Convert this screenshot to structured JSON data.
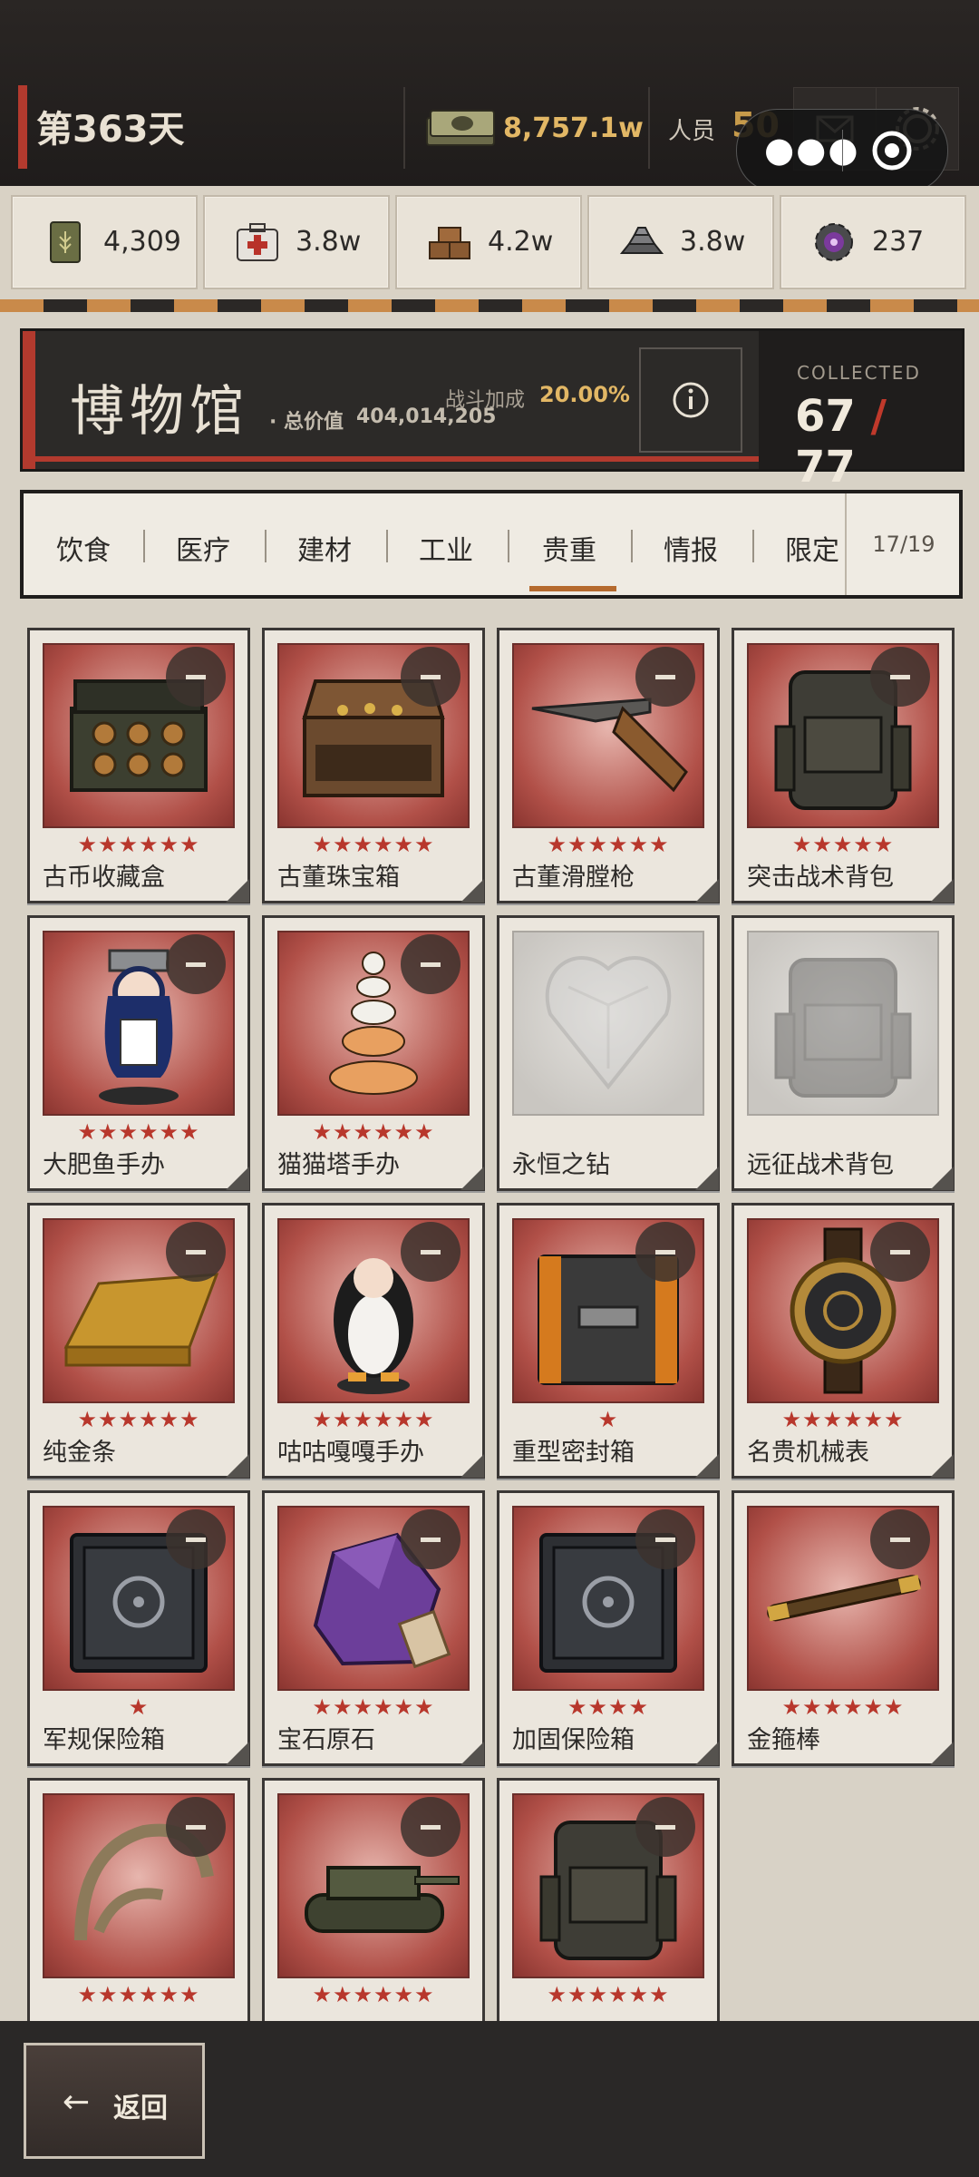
{
  "topbar": {
    "day": "第363天",
    "money": "8,757.1w",
    "people_label": "人员",
    "people_value": "50"
  },
  "resources": [
    {
      "icon": "food-can-icon",
      "value": "4,309"
    },
    {
      "icon": "medkit-icon",
      "value": "3.8w"
    },
    {
      "icon": "wood-blocks-icon",
      "value": "4.2w"
    },
    {
      "icon": "metal-ingots-icon",
      "value": "3.8w"
    },
    {
      "icon": "gear-chip-icon",
      "value": "237"
    }
  ],
  "museum": {
    "title": "博物馆",
    "total_label": "· 总价值",
    "total_value": "404,014,205",
    "bonus_label": "战斗加成",
    "bonus_value": "20.00%",
    "collected_label": "COLLECTED",
    "collected_count": "67",
    "collected_total": "77"
  },
  "tabs": {
    "items": [
      "饮食",
      "医疗",
      "建材",
      "工业",
      "贵重",
      "情报",
      "限定"
    ],
    "active": "贵重",
    "count": "17/19"
  },
  "items": [
    {
      "name": "古币收藏盒",
      "stars": "★★★★★★",
      "locked": false,
      "art": "coin-box"
    },
    {
      "name": "古董珠宝箱",
      "stars": "★★★★★★",
      "locked": false,
      "art": "jewel-chest"
    },
    {
      "name": "古董滑膛枪",
      "stars": "★★★★★★",
      "locked": false,
      "art": "musket"
    },
    {
      "name": "突击战术背包",
      "stars": "★★★★★",
      "locked": false,
      "art": "backpack"
    },
    {
      "name": "大肥鱼手办",
      "stars": "★★★★★★",
      "locked": false,
      "art": "figure-girl"
    },
    {
      "name": "猫猫塔手办",
      "stars": "★★★★★★",
      "locked": false,
      "art": "cat-tower"
    },
    {
      "name": "永恒之钻",
      "stars": "",
      "locked": true,
      "art": "diamond"
    },
    {
      "name": "远征战术背包",
      "stars": "",
      "locked": true,
      "art": "backpack"
    },
    {
      "name": "纯金条",
      "stars": "★★★★★★",
      "locked": false,
      "art": "gold-bar"
    },
    {
      "name": "咕咕嘎嘎手办",
      "stars": "★★★★★★",
      "locked": false,
      "art": "figure-penguin"
    },
    {
      "name": "重型密封箱",
      "stars": "★",
      "locked": false,
      "art": "sealed-case"
    },
    {
      "name": "名贵机械表",
      "stars": "★★★★★★",
      "locked": false,
      "art": "watch"
    },
    {
      "name": "军规保险箱",
      "stars": "★",
      "locked": false,
      "art": "safe"
    },
    {
      "name": "宝石原石",
      "stars": "★★★★★★",
      "locked": false,
      "art": "gem"
    },
    {
      "name": "加固保险箱",
      "stars": "★★★★",
      "locked": false,
      "art": "safe"
    },
    {
      "name": "金箍棒",
      "stars": "★★★★★★",
      "locked": false,
      "art": "staff"
    },
    {
      "name": "",
      "stars": "★★★★★★",
      "locked": false,
      "art": "claw"
    },
    {
      "name": "",
      "stars": "★★★★★★",
      "locked": false,
      "art": "tank"
    },
    {
      "name": "",
      "stars": "★★★★★★",
      "locked": false,
      "art": "backpack"
    }
  ],
  "bottom": {
    "back_label": "返回"
  }
}
